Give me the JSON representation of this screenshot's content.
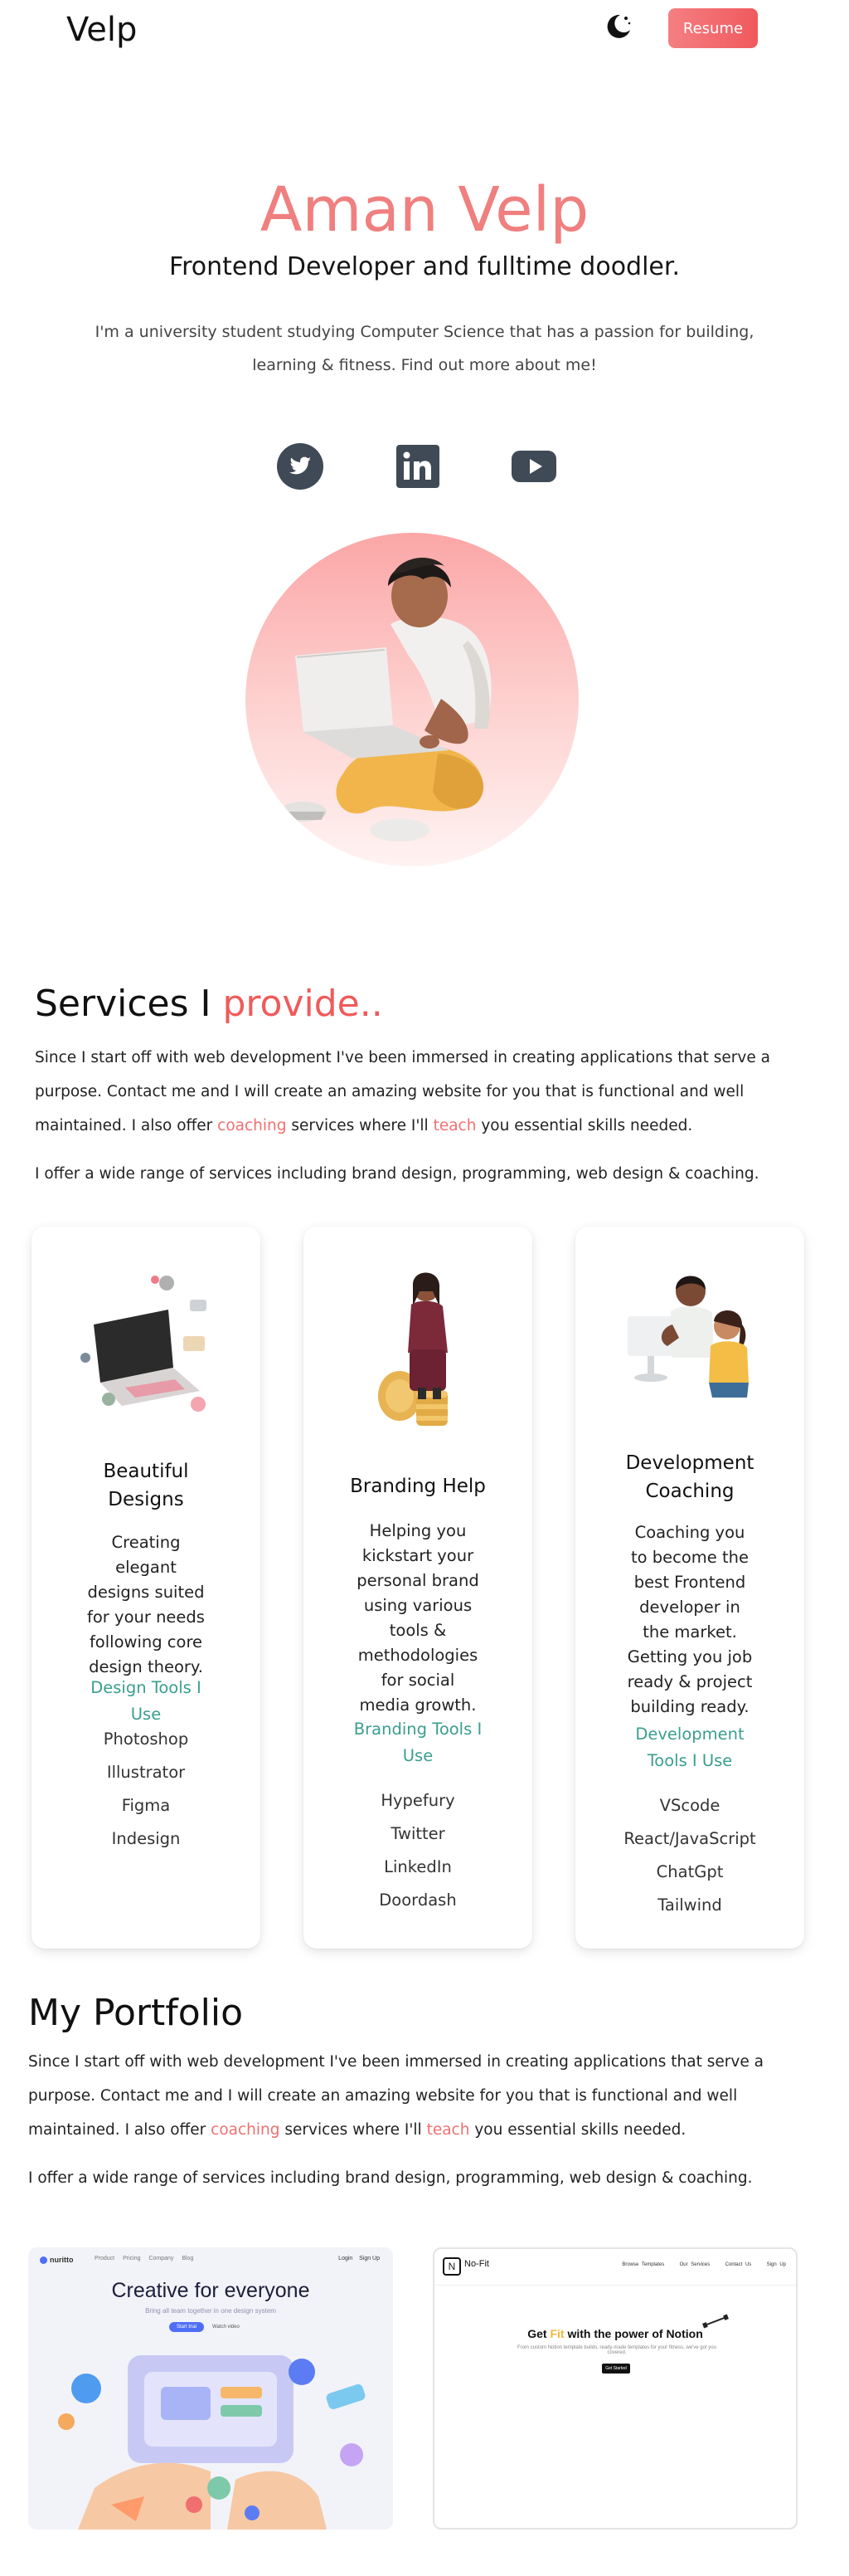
{
  "nav": {
    "logo": "Velp",
    "theme_icon": "moon-icon",
    "resume_label": "Resume"
  },
  "hero": {
    "name": "Aman Velp",
    "role": "Frontend Developer and fulltime doodler.",
    "intro": "I'm a university student studying Computer Science that has a passion for building, learning & fitness. Find out more about me!"
  },
  "social": [
    {
      "icon": "twitter-icon"
    },
    {
      "icon": "linkedin-icon"
    },
    {
      "icon": "youtube-icon"
    }
  ],
  "services": {
    "title_plain": "Services I ",
    "title_accent": "provide..",
    "p1_a": "Since I start off with web development I've been immersed in creating applications that serve a purpose. Contact me and I will create an amazing website for you that is functional and well maintained. I also offer ",
    "p1_link1": "coaching",
    "p1_b": " services where I'll ",
    "p1_link2": "teach",
    "p1_c": " you essential skills needed.",
    "p2": "I offer a wide range of services including brand design, programming, web design & coaching.",
    "cards": [
      {
        "title": "Beautiful Designs",
        "desc": "Creating elegant designs suited for your needs following core design theory.",
        "tools_heading": "Design Tools I Use",
        "tools": [
          "Photoshop",
          "Illustrator",
          "Figma",
          "Indesign"
        ]
      },
      {
        "title": "Branding Help",
        "desc": "Helping you kickstart your personal brand using various tools & methodologies for social media growth.",
        "tools_heading": "Branding Tools I Use",
        "tools": [
          "Hypefury",
          "Twitter",
          "LinkedIn",
          "Doordash"
        ]
      },
      {
        "title": "Development Coaching",
        "desc": "Coaching you to become the best Frontend developer in the market. Getting you job ready & project building ready.",
        "tools_heading": "Development Tools I Use",
        "tools": [
          "VScode",
          "React/JavaScript",
          "ChatGpt",
          "Tailwind"
        ]
      }
    ]
  },
  "portfolio": {
    "title": "My Portfolio",
    "p1_a": "Since I start off with web development I've been immersed in creating applications that serve a purpose. Contact me and I will create an amazing website for you that is functional and well maintained. I also offer ",
    "p1_link1": "coaching",
    "p1_b": " services where I'll ",
    "p1_link2": "teach",
    "p1_c": " you essential skills needed.",
    "p2": "I offer a wide range of services including brand design, programming, web design & coaching.",
    "projects": [
      {
        "brand": "nuritto",
        "nav": [
          "Product",
          "Pricing",
          "Company",
          "Blog"
        ],
        "login": "Login",
        "signup": "Sign Up",
        "headline": "Creative for everyone",
        "subline": "Bring all team together in one design system",
        "cta": "Start trial",
        "secondary": "Watch video"
      },
      {
        "brand": "No-Fit",
        "nav": [
          "Browse Templates",
          "Our Services",
          "Contact Us",
          "Sign Up"
        ],
        "headline_a": "Get ",
        "headline_b": "Fit",
        "headline_c": " with the power of Notion",
        "subline": "From custom Notion template builds, ready-made templates for your fitness, we've got you covered.",
        "cta": "Get Started"
      }
    ]
  },
  "colors": {
    "accent": "#f07f7f",
    "accent_strong": "#f05a5a",
    "teal": "#3a9e8f",
    "resume_btn": "#f0595d"
  }
}
